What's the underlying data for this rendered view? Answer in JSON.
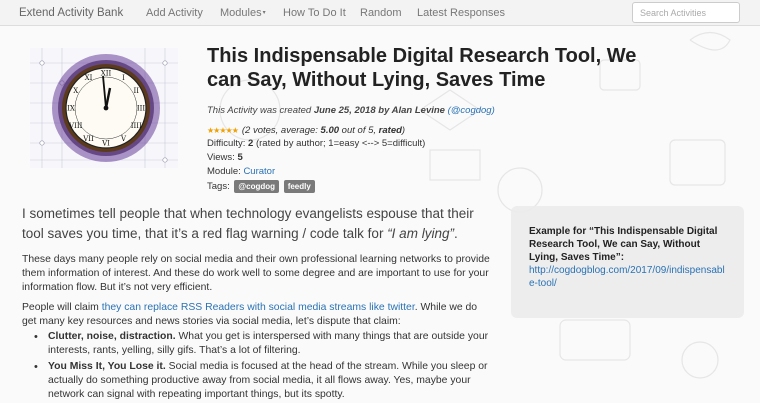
{
  "nav": {
    "brand": "Extend Activity Bank",
    "items": [
      {
        "label": "Add Activity"
      },
      {
        "label": "Modules",
        "caret": "▾"
      },
      {
        "label": "How To Do It"
      },
      {
        "label": "Random"
      },
      {
        "label": "Latest Responses"
      }
    ],
    "search_placeholder": "Search Activities"
  },
  "activity": {
    "title": "This Indispensable Digital Research Tool, We can Say, Without Lying, Saves Time",
    "created_prefix": "This Activity was created",
    "created_date": "June 25, 2018",
    "created_by": "by Alan Levine",
    "author_handle": "(@cogdog)",
    "stars": "★★★★★",
    "rating_text_a": "(2 votes, average: ",
    "rating_avg": "5.00",
    "rating_text_b": " out of 5, ",
    "rating_word": "rated",
    "rating_close": ")",
    "difficulty_label": "Difficulty: ",
    "difficulty_value": "2",
    "difficulty_note": " (rated by author; 1=easy <--> 5=difficult)",
    "views_label": "Views: ",
    "views_value": "5",
    "module_label": "Module: ",
    "module_value": "Curator",
    "tags_label": "Tags:",
    "tags": [
      "@cogdog",
      "feedly"
    ]
  },
  "body": {
    "lead_a": "I sometimes tell people that when technology evangelists espouse that their tool saves you time, that it’s a red flag warning / code talk for ",
    "lead_em": "“I am lying”",
    "lead_b": ".",
    "p1": "These days many people rely on social media and their own professional learning networks to provide them information of interest. And these do work well to some degree and are important to use for your information flow. But it’s not very efficient.",
    "p2_a": "People will claim ",
    "p2_link": "they can replace RSS Readers with social media streams like twitter",
    "p2_b": ". While we do get many key resources and news stories via social media, let’s dispute that claim:",
    "bullets": [
      {
        "bold": "Clutter, noise, distraction.",
        "text": " What you get is interspersed with many things that are outside your interests, rants, yelling, silly gifs. That’s a lot of filtering."
      },
      {
        "bold": "You Miss It, You Lose it.",
        "text": " Social media is focused at the head of the stream. While you sleep or actually do something productive away from social media, it all flows away. Yes, maybe your network can signal with repeating important things, but its spotty."
      }
    ]
  },
  "sidebar": {
    "title": "Example for “This Indispensable Digital Research Tool, We can Say, Without Lying, Saves Time”:",
    "url": "http://cogdogblog.com/2017/09/indispensable-tool/"
  },
  "clock": {
    "numerals": [
      "XII",
      "I",
      "II",
      "III",
      "IIII",
      "V",
      "VI",
      "VII",
      "VIII",
      "IX",
      "X",
      "XI"
    ]
  }
}
